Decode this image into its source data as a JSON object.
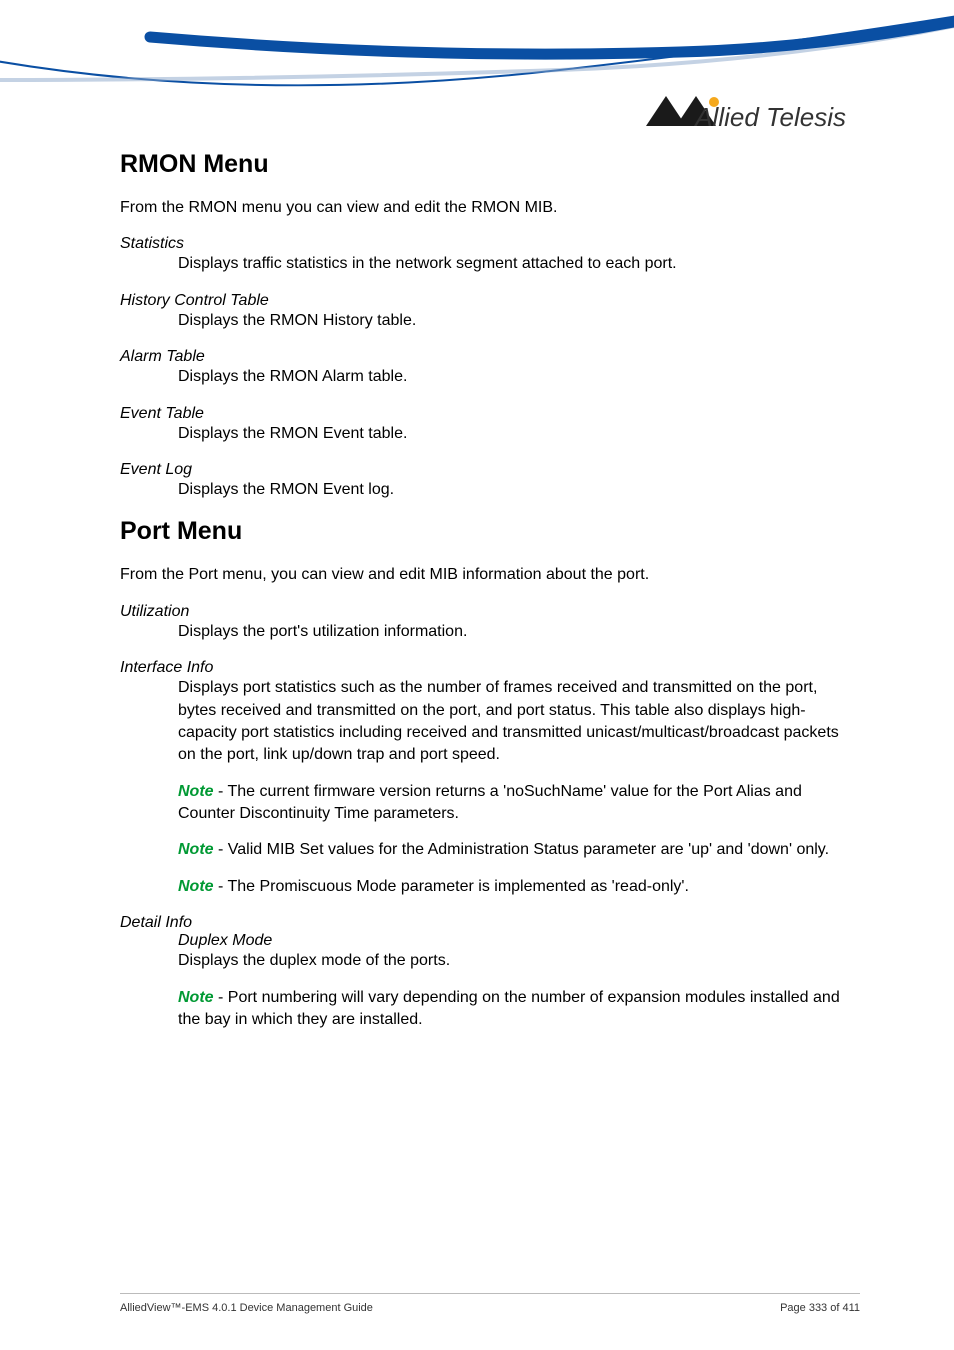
{
  "brand": {
    "name": "Allied Telesis"
  },
  "sections": {
    "rmon": {
      "title": "RMON Menu",
      "intro": "From the RMON menu you can view and edit the RMON MIB.",
      "items": [
        {
          "term": "Statistics",
          "desc": "Displays traffic statistics in the network segment attached to each port."
        },
        {
          "term": "History Control Table",
          "desc": "Displays the RMON History table."
        },
        {
          "term": "Alarm Table",
          "desc": "Displays the RMON Alarm table."
        },
        {
          "term": "Event Table",
          "desc": "Displays the RMON Event table."
        },
        {
          "term": "Event Log",
          "desc": "Displays the RMON Event log."
        }
      ]
    },
    "port": {
      "title": "Port Menu",
      "intro": "From the Port menu, you can view and edit MIB information about the port.",
      "utilization": {
        "term": "Utilization",
        "desc": "Displays the port's utilization information."
      },
      "interfaceInfo": {
        "term": "Interface Info",
        "desc": "Displays port statistics such as the number of frames received and transmitted on the port, bytes received and transmitted on the port, and port status. This table also displays high-capacity port statistics including received and transmitted unicast/multicast/broadcast packets on the port, link up/down trap and port speed.",
        "notes": [
          " - The current firmware version returns a 'noSuchName' value for the Port Alias and Counter Discontinuity Time parameters.",
          " - Valid MIB Set values for the Administration Status parameter are 'up' and 'down' only.",
          " - The Promiscuous Mode parameter is implemented as 'read-only'."
        ]
      },
      "detailInfo": {
        "term": "Detail Info",
        "subterm": "Duplex Mode",
        "subdesc": "Displays the duplex mode of the ports.",
        "note": " - Port numbering will vary depending on the number of expansion modules installed and the bay in which they are installed."
      }
    }
  },
  "noteLabel": "Note",
  "footer": {
    "left": "AlliedView™-EMS 4.0.1 Device Management Guide",
    "right": "Page 333 of 411"
  }
}
